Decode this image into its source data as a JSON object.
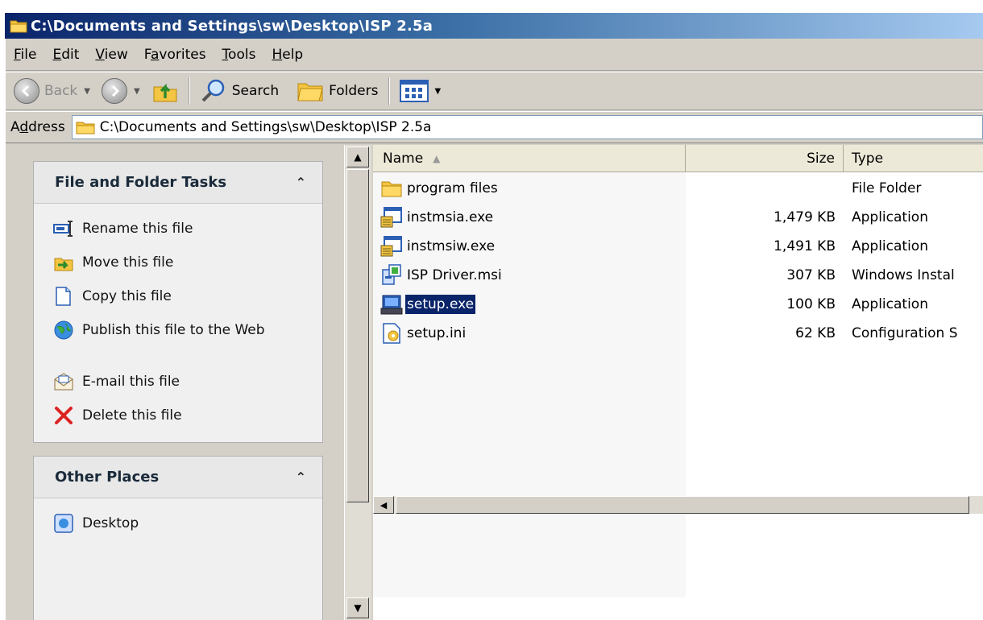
{
  "window": {
    "title": "C:\\Documents and Settings\\sw\\Desktop\\ISP 2.5a"
  },
  "menu": [
    {
      "label": "File",
      "underline": "F"
    },
    {
      "label": "Edit",
      "underline": "E"
    },
    {
      "label": "View",
      "underline": "V"
    },
    {
      "label": "Favorites",
      "underline": "a"
    },
    {
      "label": "Tools",
      "underline": "T"
    },
    {
      "label": "Help",
      "underline": "H"
    }
  ],
  "toolbar": {
    "back_label": "Back",
    "search_label": "Search",
    "folders_label": "Folders"
  },
  "address": {
    "label": "Address",
    "value": "C:\\Documents and Settings\\sw\\Desktop\\ISP 2.5a"
  },
  "file_tasks": {
    "title": "File and Folder Tasks",
    "items": [
      {
        "label": "Rename this file",
        "icon": "rename-icon"
      },
      {
        "label": "Move this file",
        "icon": "move-icon"
      },
      {
        "label": "Copy this file",
        "icon": "copy-icon"
      },
      {
        "label": "Publish this file to the Web",
        "icon": "publish-web-icon"
      },
      {
        "label": "E-mail this file",
        "icon": "email-icon"
      },
      {
        "label": "Delete this file",
        "icon": "delete-icon"
      }
    ]
  },
  "other_places": {
    "title": "Other Places",
    "items": [
      {
        "label": "Desktop",
        "icon": "desktop-icon"
      }
    ]
  },
  "columns": {
    "name": "Name",
    "size": "Size",
    "type": "Type"
  },
  "files": [
    {
      "name": "program files",
      "size": "",
      "type": "File Folder",
      "icon": "folder-icon",
      "selected": false
    },
    {
      "name": "instmsia.exe",
      "size": "1,479 KB",
      "type": "Application",
      "icon": "exe-icon",
      "selected": false
    },
    {
      "name": "instmsiw.exe",
      "size": "1,491 KB",
      "type": "Application",
      "icon": "exe-icon",
      "selected": false
    },
    {
      "name": "ISP Driver.msi",
      "size": "307 KB",
      "type": "Windows Instal",
      "icon": "msi-icon",
      "selected": false
    },
    {
      "name": "setup.exe",
      "size": "100 KB",
      "type": "Application",
      "icon": "setup-exe-icon",
      "selected": true
    },
    {
      "name": "setup.ini",
      "size": "62 KB",
      "type": "Configuration S",
      "icon": "ini-icon",
      "selected": false
    }
  ]
}
